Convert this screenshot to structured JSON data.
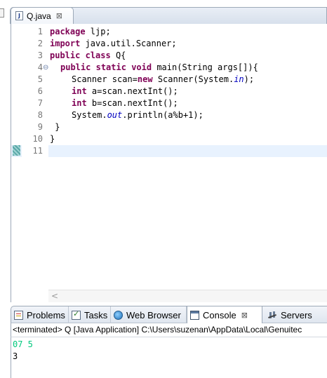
{
  "editor": {
    "tab_label": "Q.java",
    "tab_close": "⊠",
    "file_icon": "J",
    "line_numbers": [
      "1",
      "2",
      "3",
      "4",
      "5",
      "6",
      "7",
      "8",
      "9",
      "10",
      "11"
    ],
    "fold_marker": "⊖",
    "lines": {
      "l1": {
        "kw": "package",
        "rest": " ljp;"
      },
      "l2": {
        "kw": "import",
        "rest": " java.util.Scanner;"
      },
      "l3": {
        "kw1": "public",
        "kw2": "class",
        "rest": " Q{"
      },
      "l4": {
        "kw1": "public",
        "kw2": "static",
        "kw3": "void",
        "rest": " main(String args[]){"
      },
      "l5": {
        "pre": "Scanner scan=",
        "kw": "new",
        "mid": " Scanner(System.",
        "field": "in",
        "post": ");"
      },
      "l6": {
        "kw": "int",
        "rest": " a=scan.nextInt();"
      },
      "l7": {
        "kw": "int",
        "rest": " b=scan.nextInt();"
      },
      "l8": {
        "pre": "System.",
        "field": "out",
        "post": ".println(a%b+1);"
      },
      "l9": " }",
      "l10": "}"
    },
    "scroll_left_arrow": "<"
  },
  "panel": {
    "tabs": {
      "problems": "Problems",
      "tasks": "Tasks",
      "web_browser": "Web Browser",
      "console": "Console",
      "servers": "Servers"
    },
    "console_close": "⊠",
    "console_header": "<terminated> Q [Java Application] C:\\Users\\suzenan\\AppData\\Local\\Genuitec",
    "output": {
      "stdin": "07 5",
      "stdout": "3"
    }
  },
  "colors": {
    "keyword": "#7f0055",
    "field": "#0000c0",
    "stdin": "#00c87d",
    "current_line": "#e8f2fe"
  }
}
